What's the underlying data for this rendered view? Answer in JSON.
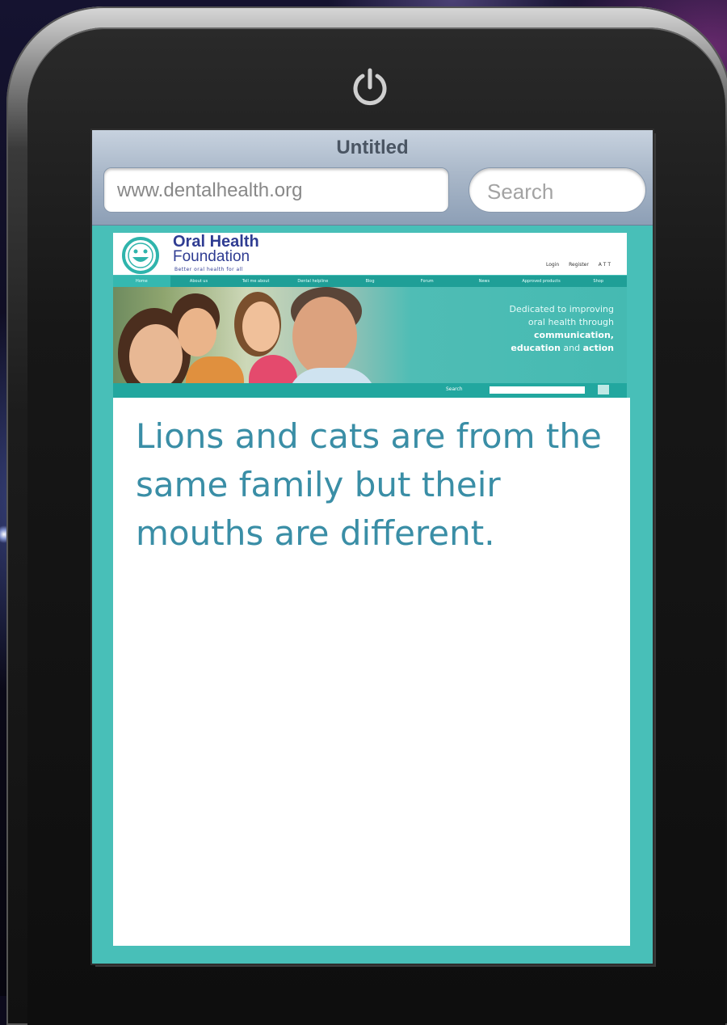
{
  "browser": {
    "title": "Untitled",
    "url": "www.dentalhealth.org",
    "search_placeholder": "Search"
  },
  "site": {
    "logo_line1": "Oral Health",
    "logo_line2": "Foundation",
    "tagline": "Better oral health for all",
    "header_links": [
      "Login",
      "Register",
      "A T T"
    ],
    "nav": [
      "Home",
      "About us",
      "Tell me about",
      "Dental helpline",
      "Blog",
      "Forum",
      "News",
      "Approved products",
      "Shop"
    ],
    "hero_text_line1": "Dedicated to improving",
    "hero_text_line2": "oral health through",
    "hero_text_line3": "communication,",
    "hero_text_line4a": "education",
    "hero_text_line4b": "and",
    "hero_text_line4c": "action",
    "hero_search_label": "Search"
  },
  "content": {
    "text": "Lions and cats are from the same family but their mouths are different."
  },
  "colors": {
    "teal": "#48bfb8",
    "nav": "#1f9f97",
    "logo_blue": "#2f3c92",
    "content_text": "#3a8ea6"
  },
  "icons": [
    "power-icon",
    "smiley-logo-icon",
    "search-icon"
  ]
}
